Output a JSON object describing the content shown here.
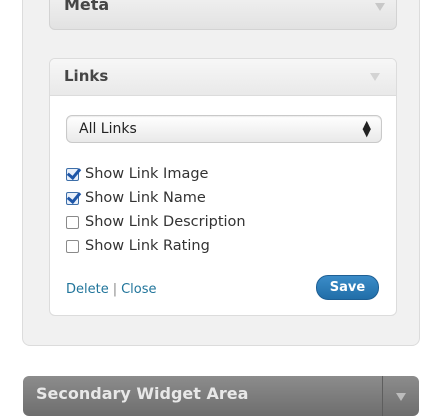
{
  "meta_widget": {
    "title": "Meta"
  },
  "links_widget": {
    "title": "Links",
    "category_select": {
      "selected": "All Links"
    },
    "options": [
      {
        "label": "Show Link Image",
        "checked": true
      },
      {
        "label": "Show Link Name",
        "checked": true
      },
      {
        "label": "Show Link Description",
        "checked": false
      },
      {
        "label": "Show Link Rating",
        "checked": false
      }
    ],
    "actions": {
      "delete": "Delete",
      "separator": "|",
      "close": "Close",
      "save": "Save"
    }
  },
  "secondary_area": {
    "title": "Secondary Widget Area"
  },
  "colors": {
    "accent": "#21759b",
    "save_button": "#2a7ab8",
    "panel_bg": "#f1f1f1"
  }
}
